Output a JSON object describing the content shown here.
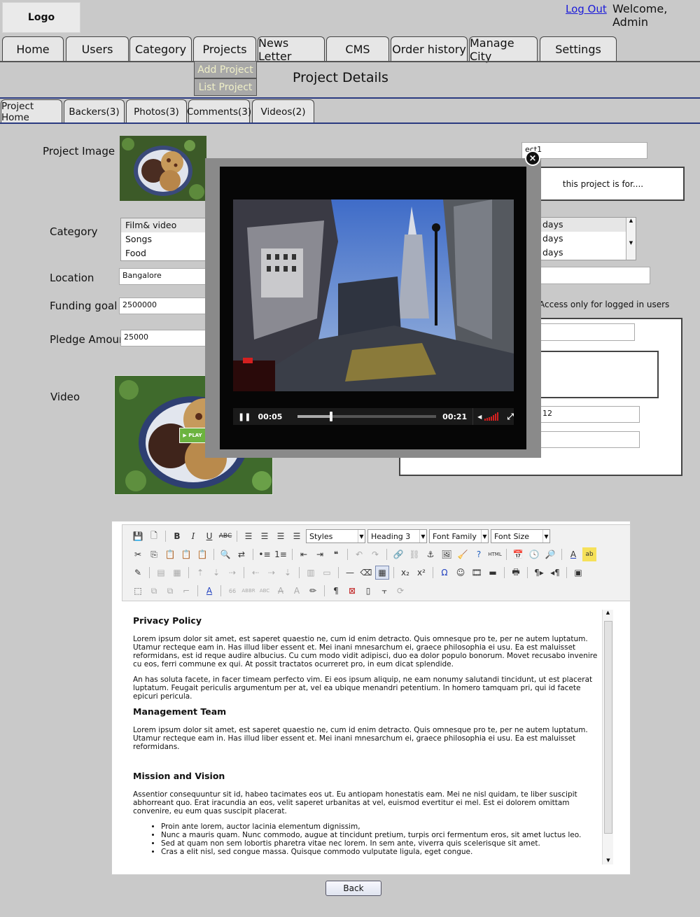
{
  "header": {
    "logo": "Logo",
    "logout": "Log Out",
    "welcome": "Welcome, Admin"
  },
  "nav": {
    "tabs": [
      "Home",
      "Users",
      "Category",
      "Projects",
      "News Letter",
      "CMS",
      "Order history",
      "Manage City",
      "Settings"
    ],
    "projects_menu": [
      "Add Project",
      "List Project"
    ]
  },
  "page_title": "Project Details",
  "subtabs": [
    "Project Home",
    "Backers(3)",
    "Photos(3)",
    "Comments(3)",
    "Videos(2)"
  ],
  "form": {
    "project_image_label": "Project Image",
    "category_label": "Category",
    "category_options": [
      "Film& video",
      "Songs",
      "Food"
    ],
    "location_label": "Location",
    "location_value": "Bangalore",
    "funding_label": "Funding goal",
    "funding_value": "2500000",
    "pledge_label": "Pledge Amount",
    "pledge_value": "25000",
    "video_label": "Video",
    "play_label": "PLAY",
    "title_value": "ect1",
    "description": "this project is for....",
    "days_options": [
      "days",
      "days",
      "days"
    ],
    "access_label": "Access only for logged in users",
    "date_value": "12"
  },
  "player": {
    "current_time": "00:05",
    "duration": "00:21",
    "progress": 0.24,
    "close": "×"
  },
  "editor": {
    "styles": "Styles",
    "format": "Heading 3",
    "font_family": "Font Family",
    "font_size": "Font Size",
    "h1": "Privacy Policy",
    "p1": "Lorem ipsum dolor sit amet, est saperet quaestio ne, cum id enim detracto. Quis omnesque pro te, per ne autem luptatum. Utamur recteque eam in. Has illud liber essent et. Mei inani mnesarchum ei, graece philosophia ei usu. Ea est maluisset reformidans, est id reque audire albucius. Cu cum modo vidit adipisci, duo ea dolor populo bonorum. Movet recusabo invenire cu eos, ferri commune ex qui. At possit tractatos ocurreret pro, in eum dicat splendide.",
    "p2": "An has soluta facete, in facer timeam perfecto vim. Ei eos ipsum aliquip, ne eam nonumy salutandi tincidunt, ut est placerat luptatum. Feugait periculis argumentum per at, vel ea ubique menandri petentium. In homero tamquam pri, qui id facete epicuri pericula.",
    "h2": "Management Team",
    "p3": "Lorem ipsum dolor sit amet, est saperet quaestio ne, cum id enim detracto. Quis omnesque pro te, per ne autem luptatum. Utamur recteque eam in. Has illud liber essent et. Mei inani mnesarchum ei, graece philosophia ei usu. Ea est maluisset reformidans.",
    "h3": "Mission and Vision",
    "p4": "Assentior consequuntur sit id, habeo tacimates eos ut. Eu antiopam honestatis eam. Mei ne nisl quidam, te liber suscipit abhorreant quo. Erat iracundia an eos, velit saperet urbanitas at vel, euismod evertitur ei mel. Est ei dolorem omittam convenire, eu eum quas suscipit placerat.",
    "bullets": [
      "Proin ante lorem, auctor lacinia elementum dignissim,",
      "Nunc a mauris quam. Nunc commodo, augue at tincidunt pretium, turpis orci fermentum eros, sit amet luctus leo.",
      "Sed at quam non sem lobortis pharetra vitae nec lorem. In sem ante, viverra quis scelerisque sit amet.",
      "Cras a elit nisl, sed congue massa. Quisque commodo vulputate ligula, eget congue."
    ]
  },
  "back_button": "Back",
  "colors": {
    "nav_line": "#2a3a80",
    "menu_text": "#f0f0c8",
    "link": "#1b1bd9",
    "play_badge": "#6cb33f",
    "volume": "#d42020"
  }
}
